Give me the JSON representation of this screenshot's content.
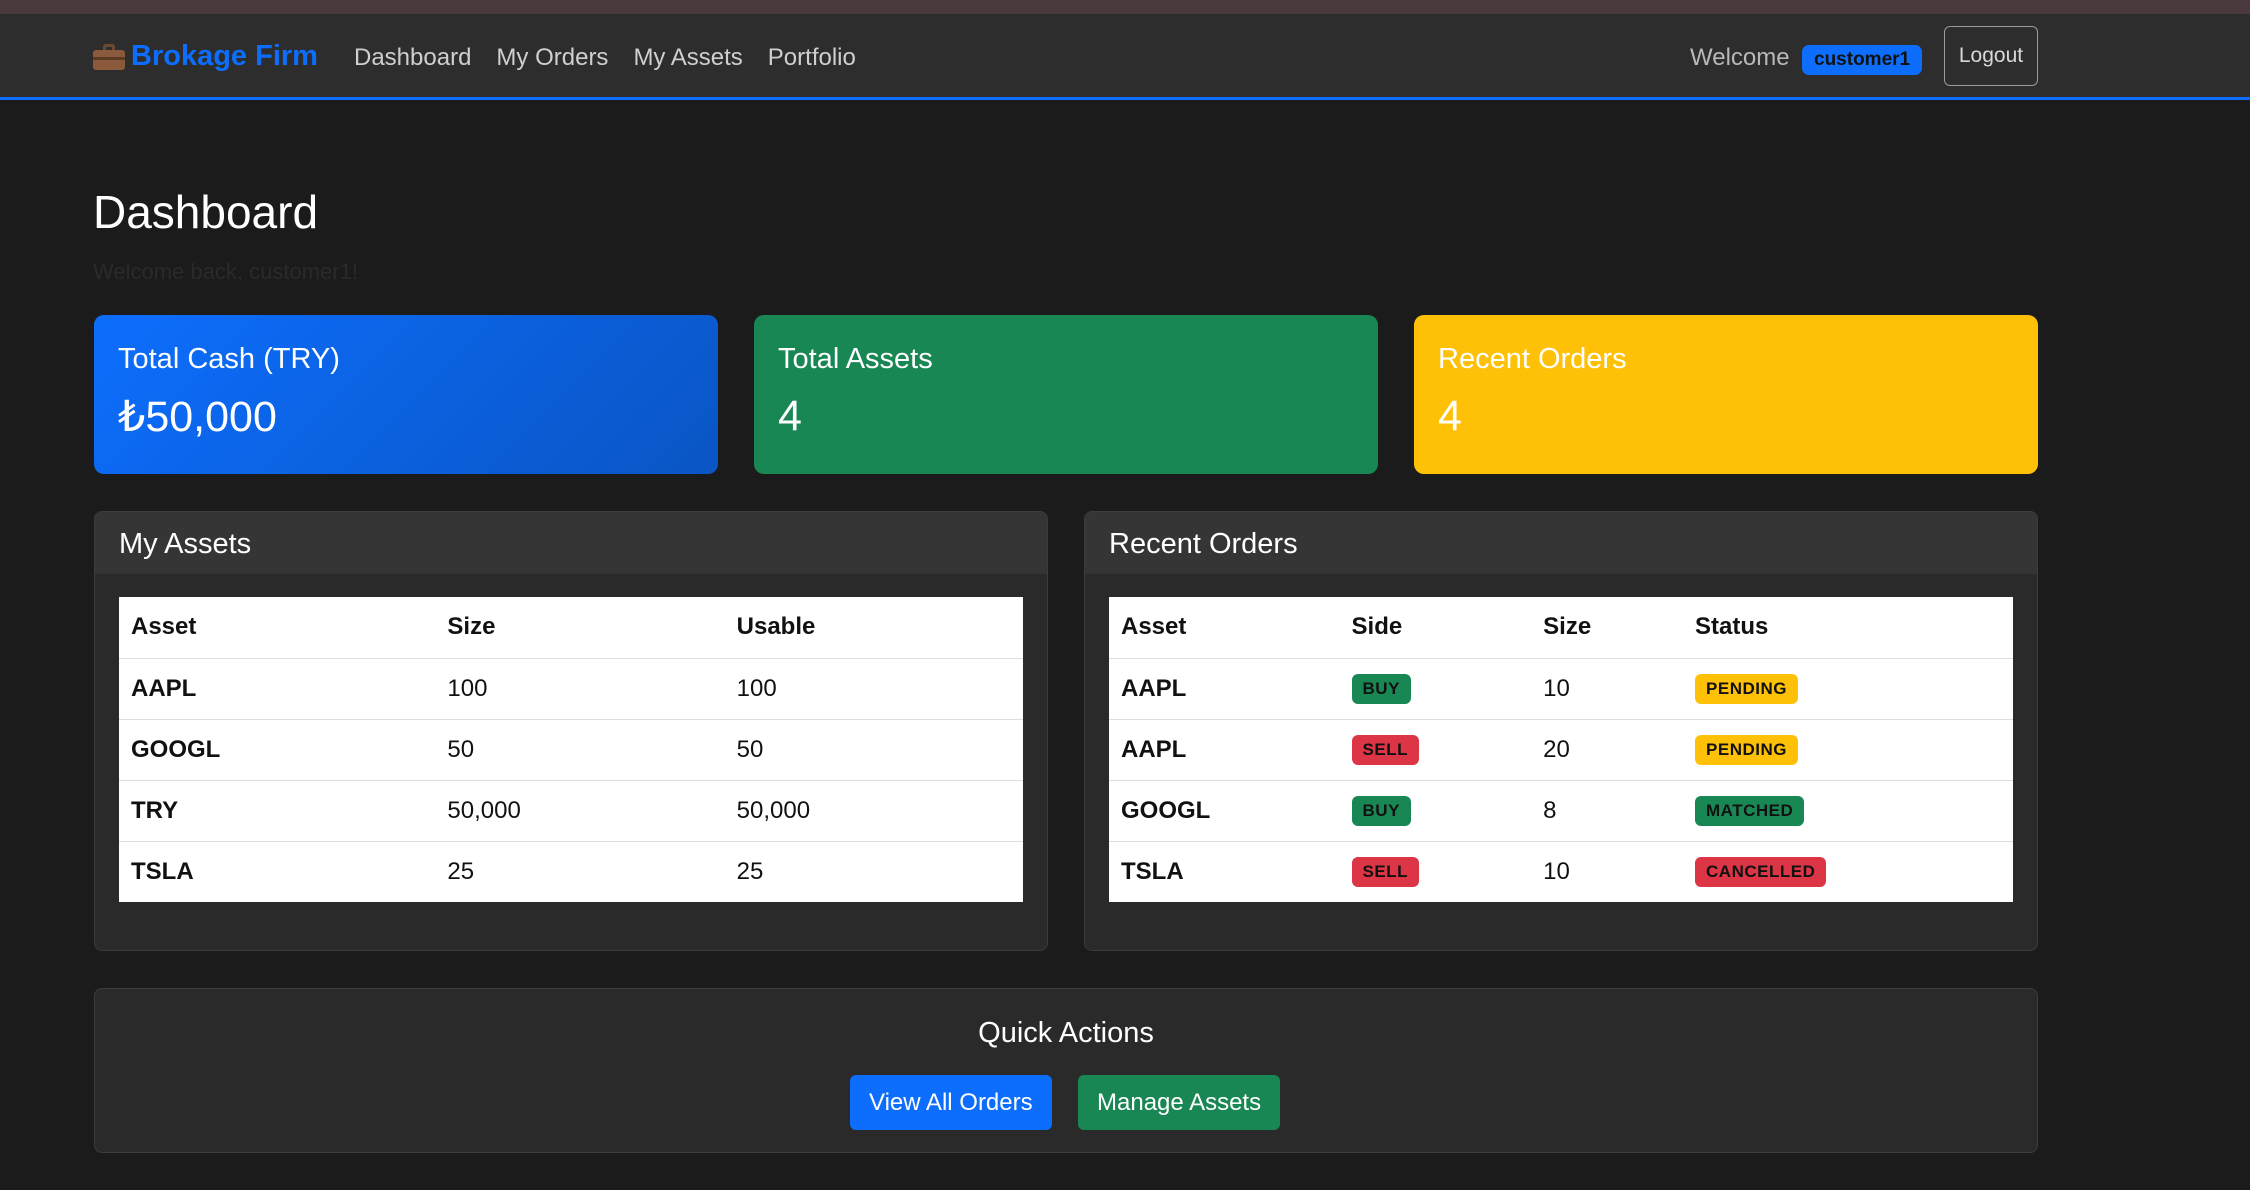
{
  "nav": {
    "brand": "Brokage Firm",
    "links": [
      "Dashboard",
      "My Orders",
      "My Assets",
      "Portfolio"
    ],
    "welcome": "Welcome",
    "username": "customer1",
    "logout": "Logout"
  },
  "page": {
    "title": "Dashboard",
    "subtitle": "Welcome back, customer1!"
  },
  "stats": {
    "cash_label": "Total Cash (TRY)",
    "cash_value": "₺50,000",
    "assets_label": "Total Assets",
    "assets_value": "4",
    "orders_label": "Recent Orders",
    "orders_value": "4"
  },
  "assets_panel": {
    "title": "My Assets",
    "headers": [
      "Asset",
      "Size",
      "Usable"
    ],
    "rows": [
      [
        "AAPL",
        "100",
        "100"
      ],
      [
        "GOOGL",
        "50",
        "50"
      ],
      [
        "TRY",
        "50,000",
        "50,000"
      ],
      [
        "TSLA",
        "25",
        "25"
      ]
    ]
  },
  "orders_panel": {
    "title": "Recent Orders",
    "headers": [
      "Asset",
      "Side",
      "Size",
      "Status"
    ],
    "rows": [
      [
        "AAPL",
        "BUY",
        "10",
        "PENDING"
      ],
      [
        "AAPL",
        "SELL",
        "20",
        "PENDING"
      ],
      [
        "GOOGL",
        "BUY",
        "8",
        "MATCHED"
      ],
      [
        "TSLA",
        "SELL",
        "10",
        "CANCELLED"
      ]
    ]
  },
  "quick_actions": {
    "title": "Quick Actions",
    "view_orders": "View All Orders",
    "manage_assets": "Manage Assets"
  },
  "colors": {
    "primary": "#0d6efd",
    "success": "#198754",
    "warning": "#ffc107",
    "danger": "#dc3545"
  }
}
